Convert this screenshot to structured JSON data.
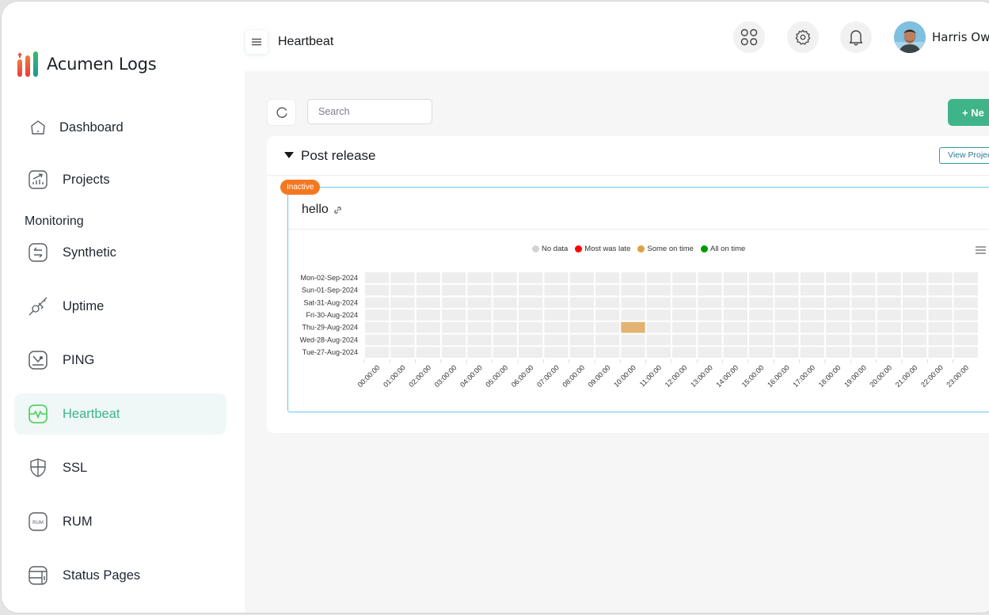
{
  "window": {
    "traffic_lights": [
      "#ee6a5f",
      "#f5bf4f",
      "#61c454"
    ]
  },
  "app": {
    "name": "Acumen Logs"
  },
  "sidebar": {
    "items": [
      {
        "label": "Dashboard",
        "icon": "home-icon"
      },
      {
        "label": "Projects",
        "icon": "chart-icon"
      }
    ],
    "section_label": "Monitoring",
    "monitoring_items": [
      {
        "label": "Synthetic",
        "icon": "arrows-swap-icon"
      },
      {
        "label": "Uptime",
        "icon": "plug-icon"
      },
      {
        "label": "PING",
        "icon": "ping-icon"
      },
      {
        "label": "Heartbeat",
        "icon": "heartbeat-icon",
        "active": true
      },
      {
        "label": "SSL",
        "icon": "shield-icon"
      },
      {
        "label": "RUM",
        "icon": "rum-icon",
        "icon_text": "RUM"
      },
      {
        "label": "Status Pages",
        "icon": "status-page-icon"
      }
    ],
    "active_color": "#3db58a"
  },
  "header": {
    "title": "Heartbeat",
    "user_name": "Harris Owen",
    "user_name_visible": "Harris Ow"
  },
  "toolbar": {
    "search_placeholder": "Search",
    "new_button_label": "+ Ne"
  },
  "group": {
    "title": "Post release",
    "view_button_label": "View Project"
  },
  "monitor": {
    "status_badge": "Inactive",
    "status_color": "#f47820",
    "name": "hello"
  },
  "chart_data": {
    "type": "heatmap",
    "title": "",
    "legend": [
      {
        "label": "No data",
        "color": "#d3d3d3"
      },
      {
        "label": "Most was late",
        "color": "#ff0000"
      },
      {
        "label": "Some on time",
        "color": "#e0a045"
      },
      {
        "label": "All on time",
        "color": "#009900"
      }
    ],
    "legend_position": "top-center",
    "y_categories": [
      "Mon-02-Sep-2024",
      "Sun-01-Sep-2024",
      "Sat-31-Aug-2024",
      "Fri-30-Aug-2024",
      "Thu-29-Aug-2024",
      "Wed-28-Aug-2024",
      "Tue-27-Aug-2024"
    ],
    "x_categories": [
      "00:00:00",
      "01:00:00",
      "02:00:00",
      "03:00:00",
      "04:00:00",
      "05:00:00",
      "06:00:00",
      "07:00:00",
      "08:00:00",
      "09:00:00",
      "10:00:00",
      "11:00:00",
      "12:00:00",
      "13:00:00",
      "14:00:00",
      "15:00:00",
      "16:00:00",
      "17:00:00",
      "18:00:00",
      "19:00:00",
      "20:00:00",
      "21:00:00",
      "22:00:00",
      "23:00:00"
    ],
    "empty_cell_color": "#eeeeee",
    "cells": [
      {
        "y": "Thu-29-Aug-2024",
        "x": "10:00:00",
        "status": "Some on time",
        "color": "#e3b373"
      }
    ]
  }
}
